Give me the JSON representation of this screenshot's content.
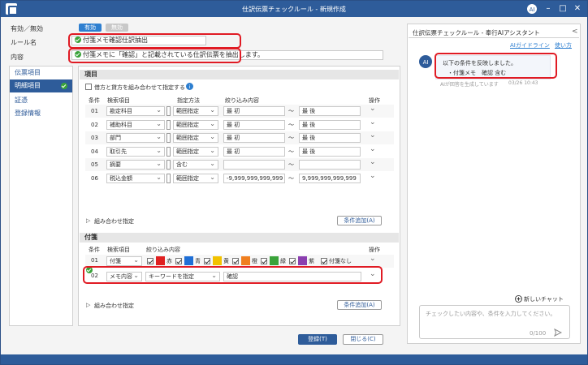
{
  "window": {
    "title": "仕訳伝票チェックルール - 新規作成"
  },
  "header": {
    "enabled_label": "有効／無効",
    "enabled_on": "有効",
    "enabled_off": "無効",
    "rule_name_label": "ルール名",
    "rule_name_value": "付箋メモ確認仕訳抽出",
    "content_label": "内容",
    "content_value": "付箋メモに「確認」と記載されている仕訳伝票を抽出します。"
  },
  "sidebar": {
    "items": [
      {
        "label": "伝票項目"
      },
      {
        "label": "明細項目"
      },
      {
        "label": "証憑"
      },
      {
        "label": "登録情報"
      }
    ]
  },
  "items_section": {
    "title": "項目",
    "combine_label": "借方と貸方を組み合わせて指定する",
    "headers": {
      "cond": "条件",
      "item": "検索項目",
      "method": "指定方法",
      "filter": "絞り込み内容",
      "op": "操作"
    },
    "rows": [
      {
        "num": "01",
        "item": "勘定科目",
        "method": "範囲指定",
        "from": "最 初",
        "to": "最 後"
      },
      {
        "num": "02",
        "item": "補助科目",
        "method": "範囲指定",
        "from": "最 初",
        "to": "最 後"
      },
      {
        "num": "03",
        "item": "部門",
        "method": "範囲指定",
        "from": "最 初",
        "to": "最 後"
      },
      {
        "num": "04",
        "item": "取引先",
        "method": "範囲指定",
        "from": "最 初",
        "to": "最 後"
      },
      {
        "num": "05",
        "item": "摘要",
        "method": "含む",
        "from": "",
        "to": ""
      },
      {
        "num": "06",
        "item": "税込金額",
        "method": "範囲指定",
        "from": "-9,999,999,999,999",
        "to": "9,999,999,999,999"
      }
    ],
    "tilde": "～",
    "combo_label": "組み合わせ指定",
    "add_button": "条件追加(A)"
  },
  "sticky_section": {
    "title": "付箋",
    "headers": {
      "cond": "条件",
      "item": "検索項目",
      "filter": "絞り込み内容",
      "op": "操作"
    },
    "row1": {
      "num": "01",
      "item": "付箋",
      "colors": [
        {
          "label": "赤",
          "color": "#e02020"
        },
        {
          "label": "青",
          "color": "#1f6fd6"
        },
        {
          "label": "黄",
          "color": "#f2c200"
        },
        {
          "label": "橙",
          "color": "#f07f1f"
        },
        {
          "label": "緑",
          "color": "#3aa33a"
        },
        {
          "label": "紫",
          "color": "#8b3fb0"
        }
      ],
      "none_label": "付箋なし"
    },
    "row2": {
      "num": "02",
      "item": "メモ内容",
      "method": "キーワードを指定",
      "value": "確認"
    },
    "combo_label": "組み合わせ指定",
    "add_button": "条件追加(A)"
  },
  "footer": {
    "register": "登録(T)",
    "close": "閉じる(C)"
  },
  "assistant": {
    "title": "仕訳伝票チェックルール - 奉行AIアシスタント",
    "guide_link": "AIガイドライン",
    "howto_link": "使い方",
    "message_line1": "以下の条件を反映しました。",
    "message_line2": "・付箋メモ　確認 含む",
    "message_sub": "AIが回答を生成しています",
    "timestamp": "03/26 10:43",
    "new_chat": "新しいチャット",
    "input_placeholder": "チェックしたい内容や、条件を入力してください。",
    "counter": "0/100"
  },
  "colors": {
    "accent": "#2e5c9a",
    "highlight": "#e01b24"
  }
}
